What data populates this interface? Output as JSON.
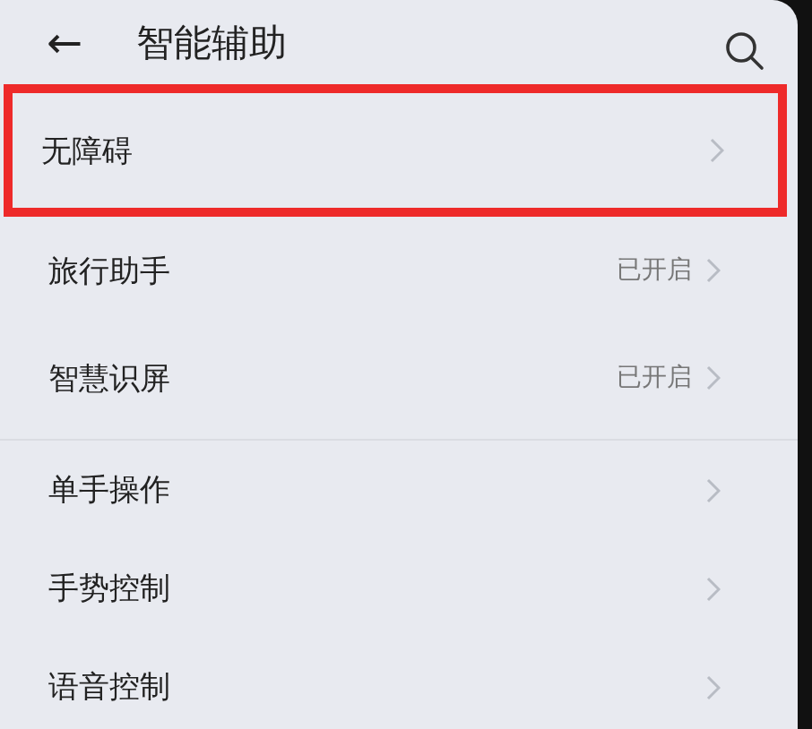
{
  "header": {
    "back_icon": "←",
    "title": "智能辅助"
  },
  "sections": [
    {
      "items": [
        {
          "label": "无障碍",
          "highlighted": true
        }
      ]
    },
    {
      "items": [
        {
          "label": "旅行助手",
          "status": "已开启",
          "highlighted": false
        },
        {
          "label": "智慧识屏",
          "status": "已开启",
          "highlighted": false
        }
      ]
    },
    {
      "items": [
        {
          "label": "单手操作",
          "highlighted": false
        },
        {
          "label": "手势控制",
          "highlighted": false
        },
        {
          "label": "语音控制",
          "highlighted": false
        }
      ]
    }
  ]
}
